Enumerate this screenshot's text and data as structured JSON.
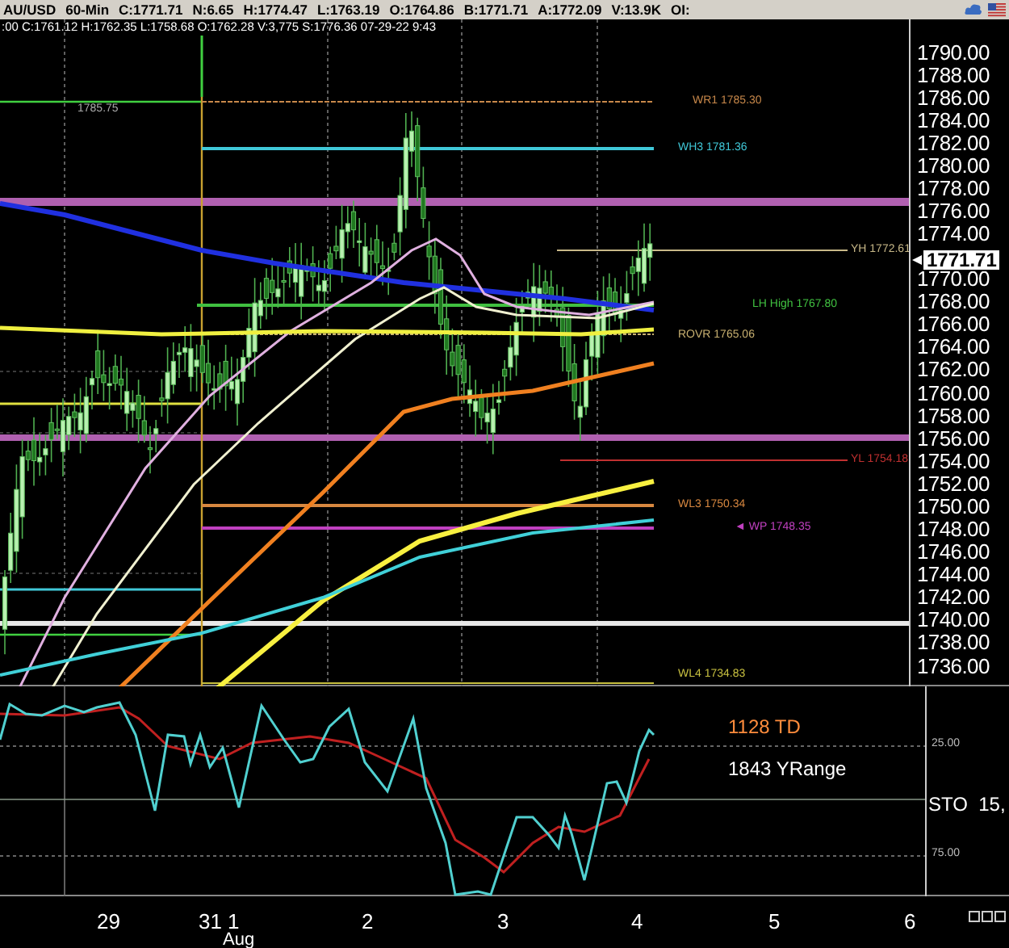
{
  "header": {
    "items": [
      "AU/USD",
      "60-Min",
      "C:1771.71",
      "N:6.65",
      "H:1774.47",
      "L:1763.19",
      "O:1764.86",
      "B:1771.71",
      "A:1772.09",
      "V:13.9K",
      "OI:"
    ]
  },
  "info_line": ":00 C:1761.12 H:1762.35 L:1758.68 O:1762.28 V:3,775 S:1776.36 07-29-22 9:43",
  "marker_label": "1785.75",
  "levels": [
    {
      "label": "WR1 1785.30",
      "color": "#c8884a"
    },
    {
      "label": "WH3 1781.36",
      "color": "#40c8d8"
    },
    {
      "label": "YH 1772.61",
      "color": "#c8b888"
    },
    {
      "label": "LH High 1767.80",
      "color": "#40c040"
    },
    {
      "label": "ROVR 1765.06",
      "color": "#c8b070"
    },
    {
      "label": "YL 1754.18",
      "color": "#c03030"
    },
    {
      "label": "WL3 1750.34",
      "color": "#d88840"
    },
    {
      "label": "◄ WP 1748.35",
      "color": "#c040c0"
    },
    {
      "label": "WL4 1734.83",
      "color": "#c8c040"
    }
  ],
  "price_axis": {
    "ticks_above": [
      "1790.00",
      "1788.00",
      "1786.00",
      "1784.00",
      "1782.00",
      "1780.00",
      "1778.00",
      "1776.00",
      "1774.00"
    ],
    "current_price": "1771.71",
    "ticks_below": [
      "1770.00",
      "1768.00",
      "1766.00",
      "1764.00",
      "1762.00",
      "1760.00",
      "1758.00",
      "1756.00",
      "1754.00",
      "1752.00",
      "1750.00",
      "1748.00",
      "1746.00",
      "1744.00",
      "1742.00",
      "1740.00",
      "1738.00",
      "1736.00"
    ]
  },
  "indicator": {
    "labels": [
      {
        "text": "1128 TD",
        "color": "#ff8c3c"
      },
      {
        "text": "1843 YRange",
        "color": "#ffffff"
      }
    ],
    "ticks": [
      "25.00",
      "75.00"
    ],
    "name": "STO  15,"
  },
  "time_axis": {
    "labels": [
      "29",
      "31",
      "1",
      "2",
      "3",
      "4",
      "5",
      "6"
    ],
    "month": "Aug"
  }
}
